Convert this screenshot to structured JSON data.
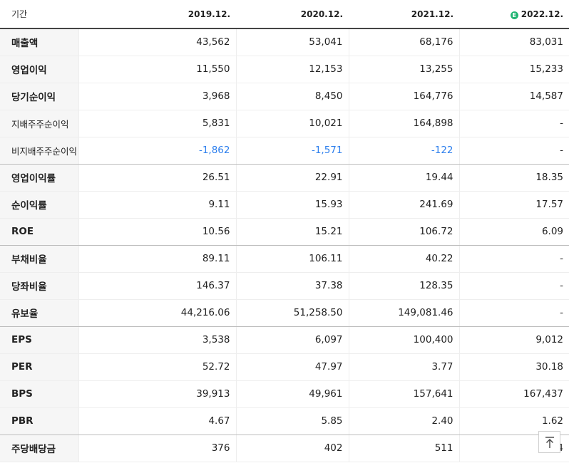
{
  "header": {
    "label": "기간",
    "estimate_mark": "E",
    "columns": [
      "2019.12.",
      "2020.12.",
      "2021.12.",
      "2022.12."
    ]
  },
  "rows": [
    {
      "label": "매출액",
      "values": [
        "43,562",
        "53,041",
        "68,176",
        "83,031"
      ]
    },
    {
      "label": "영업이익",
      "values": [
        "11,550",
        "12,153",
        "13,255",
        "15,233"
      ]
    },
    {
      "label": "당기순이익",
      "values": [
        "3,968",
        "8,450",
        "164,776",
        "14,587"
      ]
    },
    {
      "label": "지배주주순이익",
      "values": [
        "5,831",
        "10,021",
        "164,898",
        "-"
      ]
    },
    {
      "label": "비지배주주순이익",
      "values": [
        "-1,862",
        "-1,571",
        "-122",
        "-"
      ]
    },
    {
      "label": "영업이익률",
      "values": [
        "26.51",
        "22.91",
        "19.44",
        "18.35"
      ]
    },
    {
      "label": "순이익률",
      "values": [
        "9.11",
        "15.93",
        "241.69",
        "17.57"
      ]
    },
    {
      "label": "ROE",
      "values": [
        "10.56",
        "15.21",
        "106.72",
        "6.09"
      ]
    },
    {
      "label": "부채비율",
      "values": [
        "89.11",
        "106.11",
        "40.22",
        "-"
      ]
    },
    {
      "label": "당좌비율",
      "values": [
        "146.37",
        "37.38",
        "128.35",
        "-"
      ]
    },
    {
      "label": "유보율",
      "values": [
        "44,216.06",
        "51,258.50",
        "149,081.46",
        "-"
      ]
    },
    {
      "label": "EPS",
      "values": [
        "3,538",
        "6,097",
        "100,400",
        "9,012"
      ]
    },
    {
      "label": "PER",
      "values": [
        "52.72",
        "47.97",
        "3.77",
        "30.18"
      ]
    },
    {
      "label": "BPS",
      "values": [
        "39,913",
        "49,961",
        "157,641",
        "167,437"
      ]
    },
    {
      "label": "PBR",
      "values": [
        "4.67",
        "5.85",
        "2.40",
        "1.62"
      ]
    },
    {
      "label": "주당배당금",
      "values": [
        "376",
        "402",
        "511",
        "4"
      ]
    }
  ],
  "colors": {
    "negative": "#2f80ed",
    "estimate_badge": "#22b573"
  },
  "icons": {
    "scroll_top": "arrow-up-to-line-icon"
  }
}
